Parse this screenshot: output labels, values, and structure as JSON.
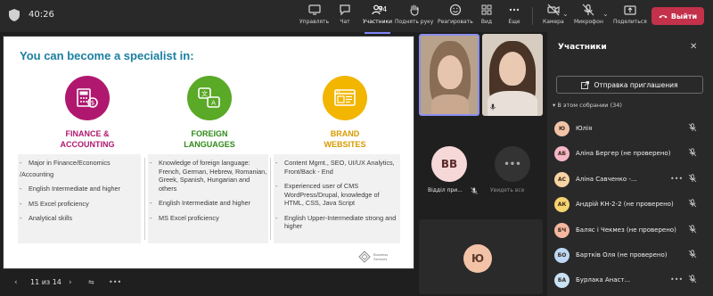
{
  "header": {
    "timer": "40:26",
    "buttons": {
      "manage": "Управлять",
      "chat": "Чат",
      "participants": "Участники",
      "participants_count": "34",
      "raise_hand": "Поднять руку",
      "react": "Реагировать",
      "view": "Вид",
      "more": "Еще",
      "camera": "Камера",
      "mic": "Микрофон",
      "share": "Поделиться",
      "leave": "Выйти"
    }
  },
  "slide": {
    "title": "You can become a specialist in:",
    "categories": [
      {
        "name_line1": "FINANCE &",
        "name_line2": "ACCOUNTING",
        "icon": "calculator-icon",
        "color": "#b0186f"
      },
      {
        "name_line1": "FOREIGN",
        "name_line2": "LANGUAGES",
        "icon": "translate-icon",
        "color": "#2f8a18"
      },
      {
        "name_line1": "BRAND",
        "name_line2": "WEBSITES",
        "icon": "browser-icon",
        "color": "#f2b500"
      }
    ],
    "columns": [
      [
        "Major in Finance/Economics",
        "/Accounting",
        "English Intermediate and higher",
        "MS Excel proficiency",
        "Analytical skills"
      ],
      [
        "Knowledge of foreign language: French, German, Hebrew, Romanian, Greek, Spanish, Hungarian and others",
        "English Intermediate and higher",
        "MS Excel proficiency"
      ],
      [
        "Content Mgmt., SEO, UI/UX Analytics, Front/Back - End",
        "Experienced user of CMS WordPress/Drupal, knowledge of HTML, CSS, Java Script",
        "English Upper-Intermediate strong and higher"
      ]
    ],
    "brand_text_1": "Business",
    "brand_text_2": "Services"
  },
  "slide_controls": {
    "page": "11 из 14",
    "more": "•••"
  },
  "tiles": {
    "bb_initials": "BB",
    "bb_name": "Відділ при...",
    "unknown_name": "Увидеть все",
    "yu_initials": "Ю"
  },
  "panel": {
    "title": "Участники",
    "invite": "Отправка приглашения",
    "section": "В этом собрании (34)",
    "participants": [
      {
        "initials": "Ю",
        "name": "Юлія",
        "color": "#f3c3a8"
      },
      {
        "initials": "АБ",
        "name": "Аліна Бергер (не проверено)",
        "color": "#f6b6c5"
      },
      {
        "initials": "АС",
        "name": "Аліна Савченко -...",
        "color": "#f8d3a3"
      },
      {
        "initials": "АК",
        "name": "Андрій КН-2-2 (не проверено)",
        "color": "#f5d36f"
      },
      {
        "initials": "БЧ",
        "name": "Баляс і Чекмез (не проверено)",
        "color": "#f4b7a0"
      },
      {
        "initials": "БО",
        "name": "Бартків Оля (не проверено)",
        "color": "#bcd8f5"
      },
      {
        "initials": "БА",
        "name": "Бурлака Анаст...",
        "color": "#c8e3f6"
      }
    ]
  }
}
